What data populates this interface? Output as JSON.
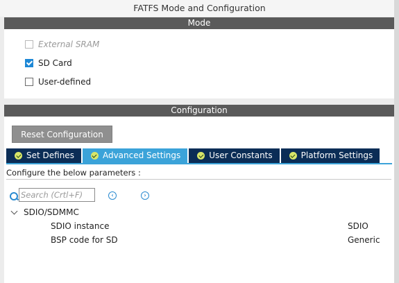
{
  "window": {
    "title": "FATFS Mode and Configuration"
  },
  "mode": {
    "header": "Mode",
    "items": [
      {
        "label": "External SRAM",
        "checked": false,
        "disabled": true
      },
      {
        "label": "SD Card",
        "checked": true,
        "disabled": false
      },
      {
        "label": "User-defined",
        "checked": false,
        "disabled": false
      }
    ]
  },
  "configuration": {
    "header": "Configuration",
    "reset_label": "Reset Configuration",
    "tabs": [
      {
        "label": "Set Defines",
        "active": false
      },
      {
        "label": "Advanced Settings",
        "active": true
      },
      {
        "label": "User Constants",
        "active": false
      },
      {
        "label": "Platform Settings",
        "active": false
      }
    ],
    "params_label": "Configure the below parameters :",
    "search": {
      "placeholder": "Search (Crtl+F)"
    },
    "group": {
      "label": "SDIO/SDMMC",
      "rows": [
        {
          "name": "SDIO instance",
          "value": "SDIO"
        },
        {
          "name": "BSP code for SD",
          "value": "Generic"
        }
      ]
    }
  },
  "colors": {
    "header_bg": "#5a5a5a",
    "tab_bg": "#0b2d56",
    "tab_active_bg": "#3ba3d9",
    "check_blue": "#1e88d6"
  }
}
